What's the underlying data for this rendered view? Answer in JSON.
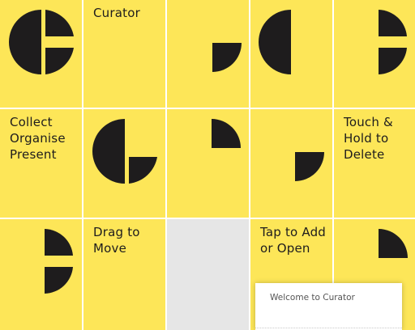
{
  "app": {
    "name": "Curator",
    "accent_color": "#fde658",
    "ink_color": "#1e1c1d",
    "empty_tile_color": "#e6e6e6"
  },
  "tiles": {
    "title": "Curator",
    "tagline": "Collect\nOrganise\nPresent",
    "delete_hint": "Touch &\nHold to\nDelete",
    "drag_hint": "Drag to\nMove",
    "add_hint": "Tap to Add\nor Open"
  },
  "icons": {
    "logo_full": "logo-c-icon",
    "quarter": "quarter-circle-icon",
    "half": "half-circle-icon",
    "notch": "notch-icon"
  },
  "toast": {
    "message": "Welcome to Curator"
  }
}
